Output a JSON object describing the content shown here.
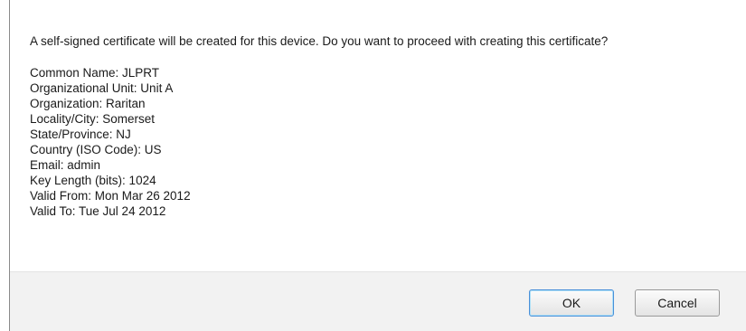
{
  "dialog": {
    "message": "A self-signed certificate will be created for this device. Do you want to proceed with creating this certificate?",
    "details": [
      "Common Name: JLPRT",
      "Organizational Unit: Unit A",
      "Organization: Raritan",
      "Locality/City: Somerset",
      "State/Province: NJ",
      "Country (ISO Code): US",
      "Email: admin",
      "Key Length (bits): 1024",
      "Valid From: Mon Mar 26 2012",
      "Valid To: Tue Jul 24 2012"
    ],
    "ok_label": "OK",
    "cancel_label": "Cancel"
  }
}
